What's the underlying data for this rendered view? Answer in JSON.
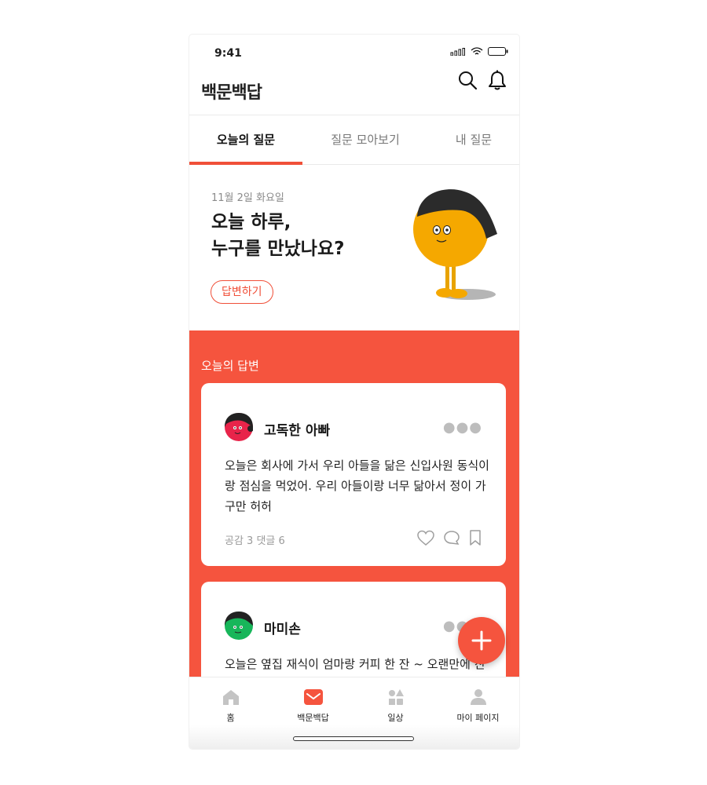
{
  "status_bar": {
    "time": "9:41"
  },
  "app": {
    "logo": "백문백답"
  },
  "tabs": [
    {
      "label": "오늘의 질문",
      "active": true
    },
    {
      "label": "질문 모아보기",
      "active": false
    },
    {
      "label": "내 질문",
      "active": false
    }
  ],
  "question": {
    "date": "11월 2일 화요일",
    "line1": "오늘 하루,",
    "line2": "누구를 만났나요?",
    "answer_button": "답변하기"
  },
  "answers_section": {
    "title": "오늘의 답변",
    "cards": [
      {
        "author": "고독한 아빠",
        "text": "오늘은 회사에 가서 우리 아들을 닮은 신입사원 동식이랑 점심을 먹었어. 우리 아들이랑 너무 닮아서 정이 가구만 허허",
        "meta": "공감 3 댓글 6"
      },
      {
        "author": "마미손",
        "text": "오늘은 옆집 재식이 엄마랑 커피 한 잔 ~ 오랜만에 친구들을 만나서 수다를 떨었더니 스트레스가 풀렸네요"
      }
    ]
  },
  "bottom_nav": [
    {
      "label": "홈",
      "icon": "home-icon"
    },
    {
      "label": "백문백답",
      "icon": "mail-icon"
    },
    {
      "label": "일상",
      "icon": "shapes-icon"
    },
    {
      "label": "마이 페이지",
      "icon": "person-icon"
    }
  ],
  "colors": {
    "accent": "#f5543e",
    "tab_underline": "#f04f38"
  }
}
